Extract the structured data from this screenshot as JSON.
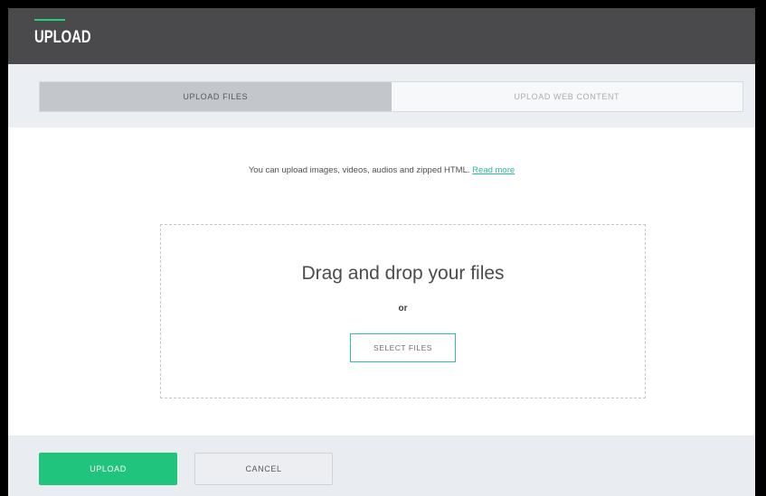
{
  "header": {
    "title": "UPLOAD"
  },
  "tabs": [
    {
      "label": "UPLOAD FILES",
      "active": true
    },
    {
      "label": "UPLOAD WEB CONTENT",
      "active": false
    }
  ],
  "info": {
    "text": "You can upload images, videos, audios and zipped HTML.",
    "link_label": "Read more"
  },
  "dropzone": {
    "title": "Drag and drop your files",
    "or_label": "or",
    "select_label": "SELECT FILES"
  },
  "footer": {
    "upload_label": "UPLOAD",
    "cancel_label": "CANCEL"
  },
  "colors": {
    "header_bg": "#4a4a4d",
    "accent_green": "#21c47c",
    "link_teal": "#2fb89e"
  }
}
